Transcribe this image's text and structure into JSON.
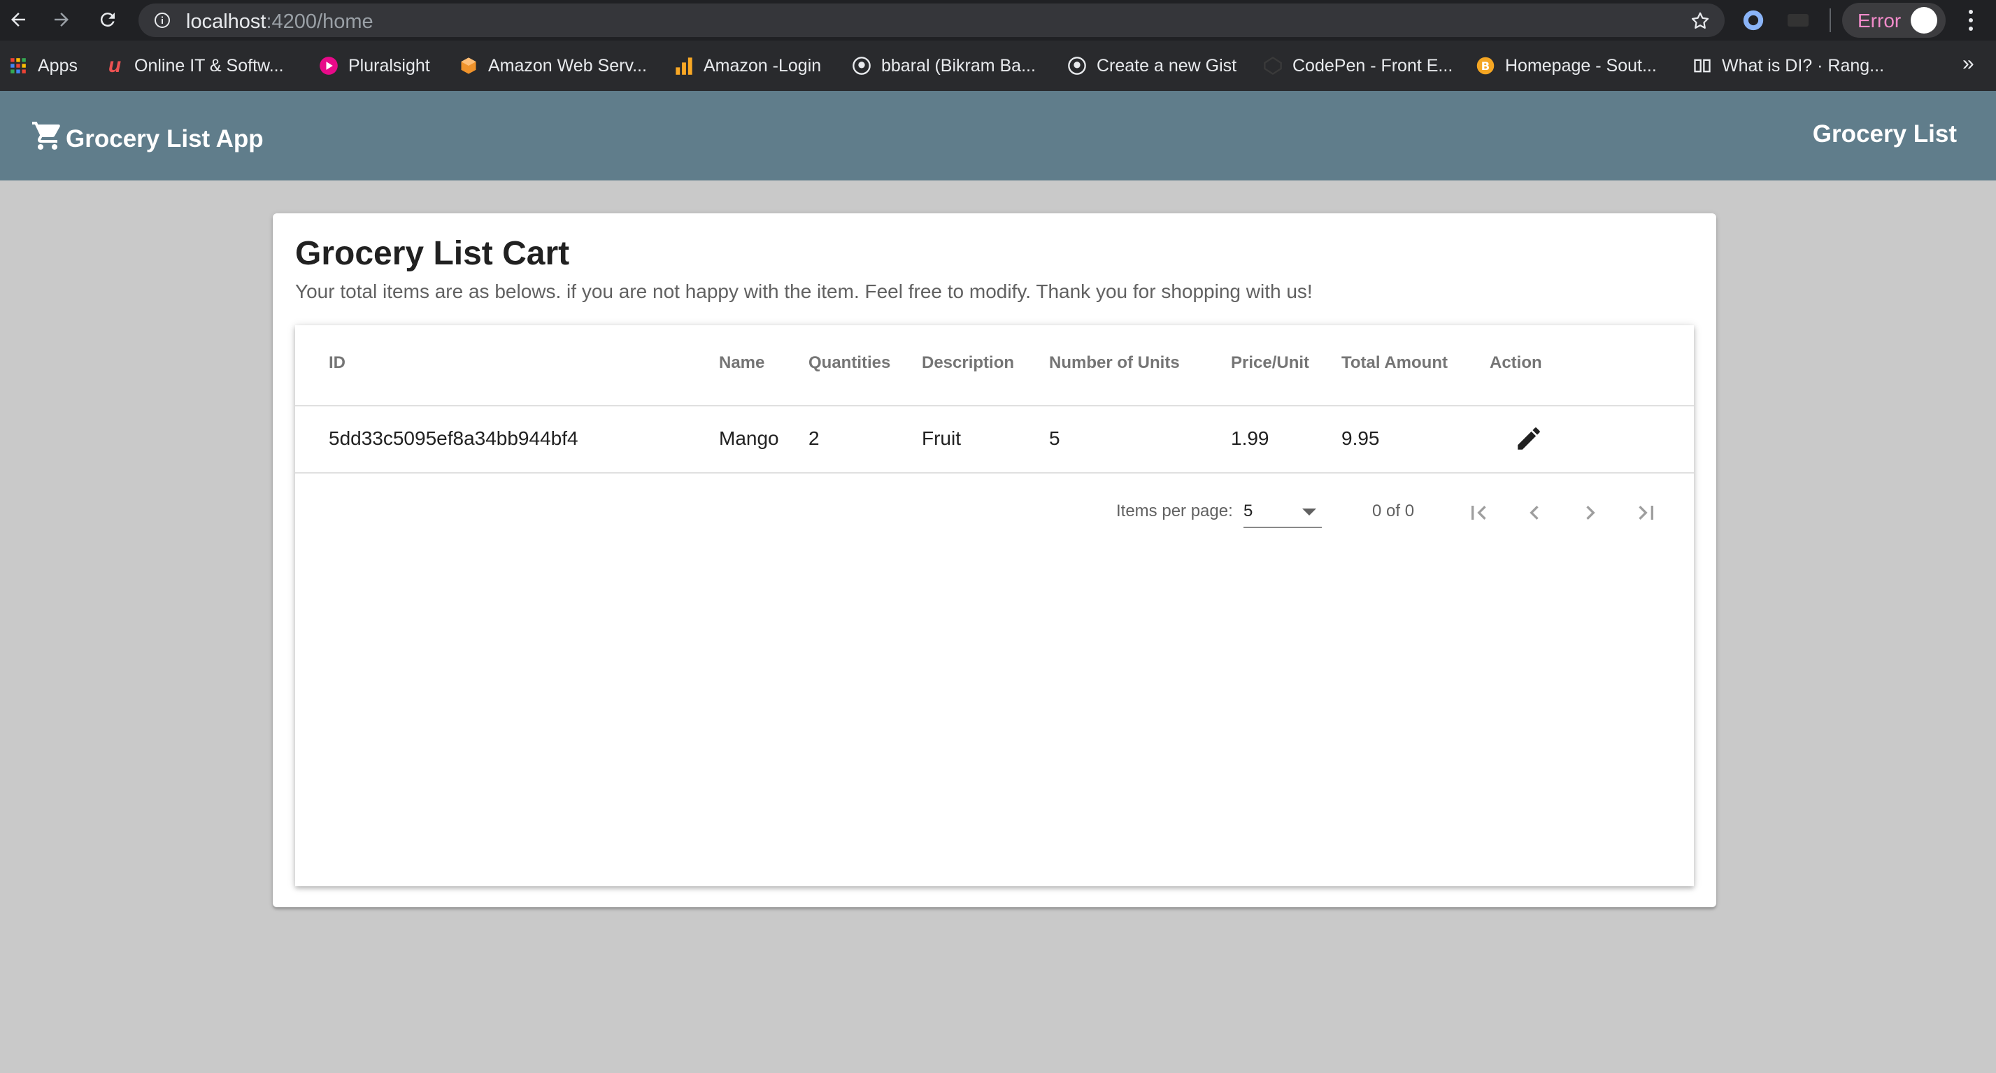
{
  "browser": {
    "url_host": "localhost",
    "url_path": ":4200/home",
    "profile_error": "Error",
    "bookmarks": [
      {
        "label": "Apps",
        "icon": "apps-grid-icon"
      },
      {
        "label": "Online IT & Softw...",
        "icon": "udemy-icon"
      },
      {
        "label": "Pluralsight",
        "icon": "pluralsight-icon"
      },
      {
        "label": "Amazon Web Serv...",
        "icon": "aws-icon"
      },
      {
        "label": "Amazon -Login",
        "icon": "amazon-login-icon"
      },
      {
        "label": "bbaral (Bikram Ba...",
        "icon": "github-icon"
      },
      {
        "label": "Create a new Gist",
        "icon": "github-icon"
      },
      {
        "label": "CodePen - Front E...",
        "icon": "codepen-icon"
      },
      {
        "label": "Homepage - Sout...",
        "icon": "homepage-icon"
      },
      {
        "label": "What is DI? · Rang...",
        "icon": "book-icon"
      }
    ],
    "more_bookmarks": "»"
  },
  "toolbar": {
    "brand": "Grocery List App",
    "brand_icon": "shopping-cart-icon",
    "right_title": "Grocery List"
  },
  "card": {
    "title": "Grocery List Cart",
    "subtitle": "Your total items are as belows. if you are not happy with the item. Feel free to modify. Thank you for shopping with us!"
  },
  "table": {
    "headers": [
      "ID",
      "Name",
      "Quantities",
      "Description",
      "Number of Units",
      "Price/Unit",
      "Total Amount",
      "Action"
    ],
    "rows": [
      {
        "id": "5dd33c5095ef8a34bb944bf4",
        "name": "Mango",
        "quantities": "2",
        "description": "Fruit",
        "units": "5",
        "price": "1.99",
        "total": "9.95",
        "action_icon": "edit-pencil-icon"
      }
    ]
  },
  "paginator": {
    "items_per_page_label": "Items per page:",
    "items_per_page_value": "5",
    "range_label": "0 of 0"
  },
  "colors": {
    "toolbar": "#607d8b",
    "page_bg": "#c9c9c9",
    "browser_bar": "#202124"
  }
}
